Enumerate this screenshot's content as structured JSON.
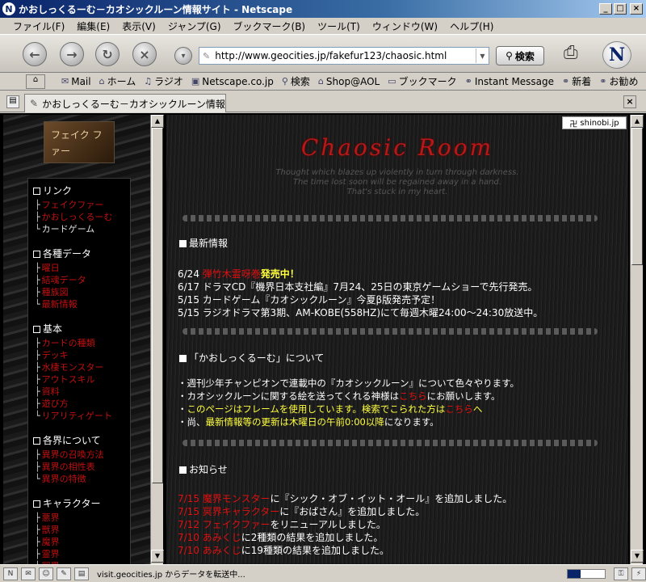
{
  "window": {
    "title": "かおしっくるーむ－カオシックルーン情報サイト - Netscape",
    "app_glyph": "N"
  },
  "menu": [
    "ファイル(F)",
    "編集(E)",
    "表示(V)",
    "ジャンプ(G)",
    "ブックマーク(B)",
    "ツール(T)",
    "ウィンドウ(W)",
    "ヘルプ(H)"
  ],
  "nav": {
    "url": "http://www.geocities.jp/fakefur123/chaosic.html",
    "search_label": "検索",
    "logo_glyph": "N"
  },
  "personal_toolbar": [
    "Mail",
    "ホーム",
    "ラジオ",
    "Netscape.co.jp",
    "検索",
    "Shop@AOL",
    "ブックマーク",
    "Instant Message",
    "新着",
    "お勧め"
  ],
  "tab": {
    "label": "かおしっくるーむ－カオシックルーン情報サイト"
  },
  "left_frame": {
    "logo_text": "フェイク ファー",
    "sections": [
      {
        "head": "リンク",
        "items": [
          {
            "label": "フェイクファー",
            "color": "red"
          },
          {
            "label": "かおしっくるーむ",
            "color": "red"
          },
          {
            "label": "カードゲーム",
            "color": "white"
          }
        ]
      },
      {
        "head": "各種データ",
        "items": [
          {
            "label": "曜日",
            "color": "red"
          },
          {
            "label": "結魂データ",
            "color": "red"
          },
          {
            "label": "種族図",
            "color": "red"
          },
          {
            "label": "最新情報",
            "color": "red"
          }
        ]
      },
      {
        "head": "基本",
        "items": [
          {
            "label": "カードの種類",
            "color": "red"
          },
          {
            "label": "デッキ",
            "color": "red"
          },
          {
            "label": "水棲モンスター",
            "color": "red"
          },
          {
            "label": "アウトスキル",
            "color": "red"
          },
          {
            "label": "資料",
            "color": "red"
          },
          {
            "label": "遊び方",
            "color": "red"
          },
          {
            "label": "リアリティゲート",
            "color": "red"
          }
        ]
      },
      {
        "head": "各界について",
        "items": [
          {
            "label": "異界の召喚方法",
            "color": "red"
          },
          {
            "label": "異界の相性表",
            "color": "red"
          },
          {
            "label": "異界の特徴",
            "color": "red"
          }
        ]
      },
      {
        "head": "キャラクター",
        "items": [
          {
            "label": "悪界",
            "color": "red"
          },
          {
            "label": "獣界",
            "color": "red"
          },
          {
            "label": "魔界",
            "color": "red"
          },
          {
            "label": "霊界",
            "color": "red"
          },
          {
            "label": "冥界",
            "color": "red"
          }
        ]
      }
    ]
  },
  "main": {
    "shinobi": "shinobi.jp",
    "site_title": "Chaosic Room",
    "tagline": [
      "Thought which blazes up violently in turn through darkness.",
      "The time lost soon will be regained away in a hand.",
      "That's stuck in my heart."
    ],
    "news_head": "最新情報",
    "news": [
      {
        "date": "6/24",
        "parts": [
          {
            "t": "弾竹木霊呀巻",
            "c": "red"
          },
          {
            "t": "発売中！",
            "c": "yellow"
          }
        ]
      },
      {
        "date": "6/17",
        "parts": [
          {
            "t": "ドラマCD『機界日本支社編』7月24、25日の東京ゲームショーで先行発売。",
            "c": "white"
          }
        ]
      },
      {
        "date": "5/15",
        "parts": [
          {
            "t": "カードゲーム『カオシックルーン』今夏β版発売予定！",
            "c": "white"
          }
        ]
      },
      {
        "date": "5/15",
        "parts": [
          {
            "t": "ラジオドラマ第3期、AM-KOBE(558HZ)にて毎週木曜24:00～24:30放送中。",
            "c": "white"
          }
        ]
      }
    ],
    "about_head": "「かおしっくるーむ」について",
    "about": [
      [
        {
          "t": "・週刊少年チャンピオンで連載中の『カオシックルーン』について色々やります。",
          "c": "white"
        }
      ],
      [
        {
          "t": "・カオシックルーンに関する絵を送ってくれる神様は",
          "c": "white"
        },
        {
          "t": "こちら",
          "c": "red"
        },
        {
          "t": "にお願いします。",
          "c": "white"
        }
      ],
      [
        {
          "t": "・",
          "c": "white"
        },
        {
          "t": "このページはフレームを使用しています。検索でこられた方は",
          "c": "yellow-n"
        },
        {
          "t": "こちら",
          "c": "red"
        },
        {
          "t": "へ",
          "c": "yellow-n"
        }
      ],
      [
        {
          "t": "・尚、",
          "c": "white"
        },
        {
          "t": "最新情報等の更新は木曜日の午前0:00以降",
          "c": "yellow-n"
        },
        {
          "t": "になります。",
          "c": "white"
        }
      ]
    ],
    "notice_head": "お知らせ",
    "notices": [
      {
        "date": "7/15",
        "parts": [
          {
            "t": "魔界モンスター",
            "c": "red"
          },
          {
            "t": "に『シック・オブ・イット・オール』を追加しました。",
            "c": "white"
          }
        ]
      },
      {
        "date": "7/15",
        "parts": [
          {
            "t": "冥界キャラクター",
            "c": "red"
          },
          {
            "t": "に『おばさん』を追加しました。",
            "c": "white"
          }
        ]
      },
      {
        "date": "7/12",
        "parts": [
          {
            "t": "フェイクファー",
            "c": "red"
          },
          {
            "t": "をリニューアルしました。",
            "c": "white"
          }
        ]
      },
      {
        "date": "7/10",
        "parts": [
          {
            "t": "あみくじ",
            "c": "red"
          },
          {
            "t": "に2種類の結果を追加しました。",
            "c": "white"
          }
        ]
      },
      {
        "date": "7/10",
        "parts": [
          {
            "t": "あみくじ",
            "c": "red"
          },
          {
            "t": "に19種類の結果を追加しました。",
            "c": "white"
          }
        ]
      }
    ]
  },
  "status": {
    "text": "visit.geocities.jp からデータを転送中...",
    "progress": 0.35
  }
}
